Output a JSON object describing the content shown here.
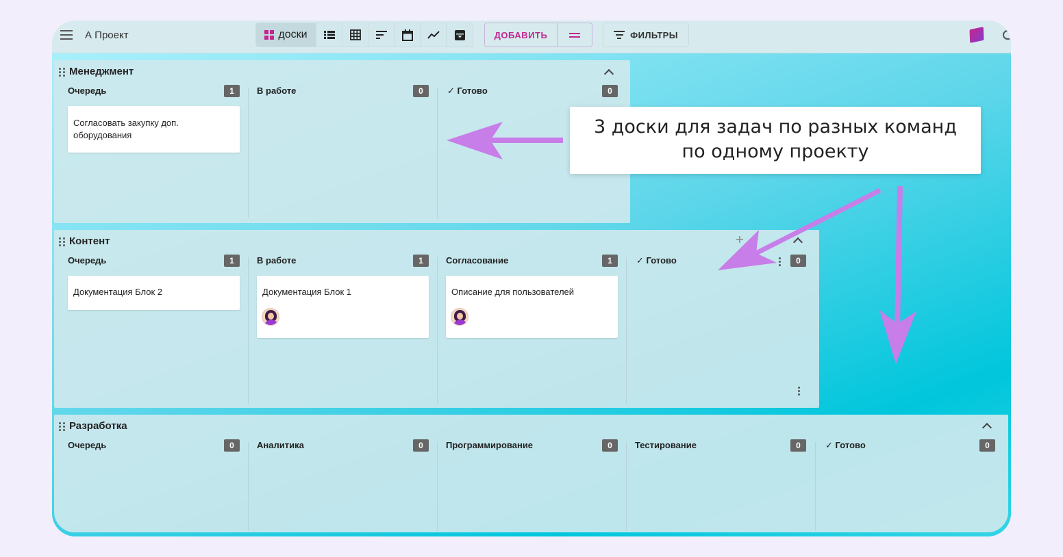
{
  "header": {
    "menu_icon": "hamburger-icon",
    "project_title": "А Проект",
    "views": [
      {
        "icon": "boards-icon",
        "label": "доски",
        "active": true
      },
      {
        "icon": "list-icon"
      },
      {
        "icon": "table-icon"
      },
      {
        "icon": "gantt-icon"
      },
      {
        "icon": "calendar-icon"
      },
      {
        "icon": "chart-icon"
      },
      {
        "icon": "archive-icon"
      }
    ],
    "add_label": "ДОБАВИТЬ",
    "filters_label": "ФИЛЬТРЫ",
    "accent_color": "#c2268d"
  },
  "boards": [
    {
      "title": "Менеджмент",
      "columns": [
        {
          "title": "Очередь",
          "count": "1",
          "cards": [
            {
              "text": "Согласовать закупку доп. оборудования"
            }
          ]
        },
        {
          "title": "В работе",
          "count": "0",
          "cards": []
        },
        {
          "title": "Готово",
          "count": "0",
          "done": true,
          "cards": []
        }
      ]
    },
    {
      "title": "Контент",
      "columns": [
        {
          "title": "Очередь",
          "count": "1",
          "cards": [
            {
              "text": "Документация Блок 2"
            }
          ]
        },
        {
          "title": "В работе",
          "count": "1",
          "cards": [
            {
              "text": "Документация Блок 1",
              "avatar": true
            }
          ]
        },
        {
          "title": "Согласование",
          "count": "1",
          "cards": [
            {
              "text": "Описание для пользователей",
              "avatar": true
            }
          ]
        },
        {
          "title": "Готово",
          "count": "0",
          "done": true,
          "cards": []
        }
      ]
    },
    {
      "title": "Разработка",
      "columns": [
        {
          "title": "Очередь",
          "count": "0",
          "cards": []
        },
        {
          "title": "Аналитика",
          "count": "0",
          "cards": []
        },
        {
          "title": "Программирование",
          "count": "0",
          "cards": []
        },
        {
          "title": "Тестирование",
          "count": "0",
          "cards": []
        },
        {
          "title": "Готово",
          "count": "0",
          "done": true,
          "cards": []
        }
      ]
    }
  ],
  "callout": {
    "line1": "3 доски для задач по разных команд",
    "line2": "по одному проекту"
  },
  "arrow_color": "#c77ee8"
}
